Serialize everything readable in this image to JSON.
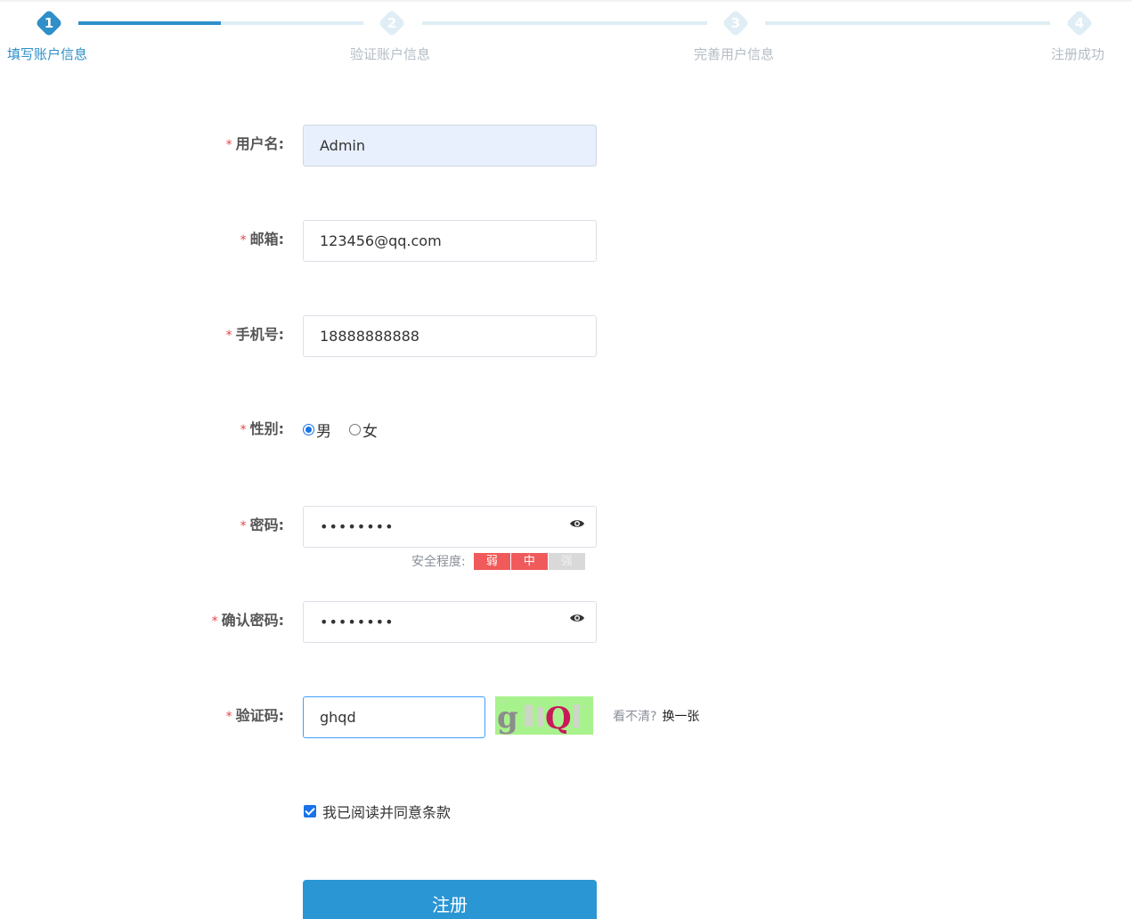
{
  "steps": [
    {
      "num": "1",
      "label": "填写账户信息",
      "active": true
    },
    {
      "num": "2",
      "label": "验证账户信息",
      "active": false
    },
    {
      "num": "3",
      "label": "完善用户信息",
      "active": false
    },
    {
      "num": "4",
      "label": "注册成功",
      "active": false
    }
  ],
  "progress": 0.5,
  "form": {
    "required_mark": "*",
    "username": {
      "label": "用户名:",
      "value": "Admin"
    },
    "email": {
      "label": "邮箱:",
      "value": "123456@qq.com"
    },
    "phone": {
      "label": "手机号:",
      "value": "18888888888"
    },
    "gender": {
      "label": "性别:",
      "options": [
        "男",
        "女"
      ],
      "selected": "男"
    },
    "password": {
      "label": "密码:",
      "value": "••••••••"
    },
    "strength": {
      "label": "安全程度:",
      "levels": [
        "弱",
        "中",
        "强"
      ],
      "level": 2
    },
    "confirm_password": {
      "label": "确认密码:",
      "value": "••••••••"
    },
    "captcha": {
      "label": "验证码:",
      "value": "ghqd",
      "image_text": "gQ",
      "tip": "看不清?",
      "change": "换一张"
    },
    "agree_text": "我已阅读并同意条款",
    "submit_label": "注册"
  },
  "colors": {
    "accent": "#2e8fc9",
    "button": "#2a96d4",
    "required": "#e7434b",
    "strength_on": "#f15a5a"
  }
}
